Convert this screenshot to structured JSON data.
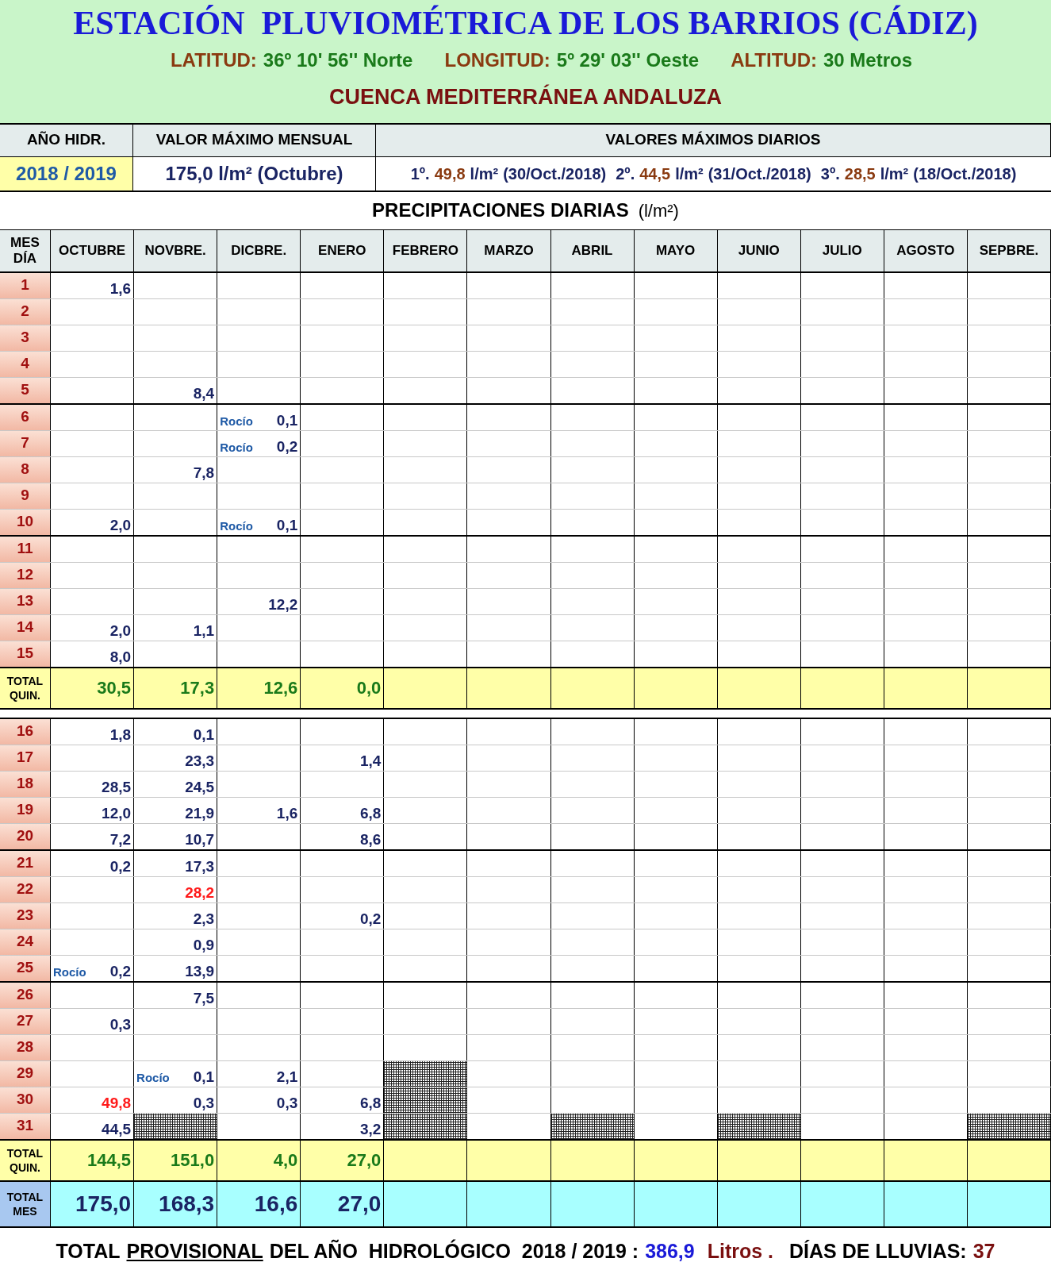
{
  "title": "ESTACIÓN  PLUVIOMÉTRICA DE LOS BARRIOS (CÁDIZ)",
  "coordinates": [
    {
      "label": "LATITUD:",
      "value": "36º 10' 56'' Norte"
    },
    {
      "label": "LONGITUD:",
      "value": "5º 29' 03'' Oeste"
    },
    {
      "label": "ALTITUD:",
      "value": "30 Metros"
    }
  ],
  "basin": "CUENCA MEDITERRÁNEA ANDALUZA",
  "summary": {
    "headers": [
      "AÑO HIDR.",
      "VALOR  MÁXIMO  MENSUAL",
      "VALORES  MÁXIMOS  DIARIOS"
    ],
    "year": "2018 / 2019",
    "monthly_max": "175,0 l/m² (Octubre)",
    "daily_max": [
      {
        "rank": "1º.",
        "value": "49,8",
        "unit": "l/m²",
        "date": "(30/Oct./2018)"
      },
      {
        "rank": "2º.",
        "value": "44,5",
        "unit": "l/m²",
        "date": "(31/Oct./2018)"
      },
      {
        "rank": "3º.",
        "value": "28,5",
        "unit": "l/m²",
        "date": "(18/Oct./2018)"
      }
    ]
  },
  "table_title": {
    "text": "PRECIPITACIONES  DIARIAS",
    "unit": "(l/m²)"
  },
  "corner_header": [
    "MES",
    "DÍA"
  ],
  "months": [
    "OCTUBRE",
    "NOVBRE.",
    "DICBRE.",
    "ENERO",
    "FEBRERO",
    "MARZO",
    "ABRIL",
    "MAYO",
    "JUNIO",
    "JULIO",
    "AGOSTO",
    "SEPBRE."
  ],
  "halves": [
    {
      "groups": [
        {
          "rows": [
            {
              "day": "1",
              "cells": [
                {
                  "kind": "value",
                  "value": "1,6",
                  "highlight": false
                }
              ]
            },
            {
              "day": "2",
              "cells": []
            },
            {
              "day": "3",
              "cells": []
            },
            {
              "day": "4",
              "cells": []
            },
            {
              "day": "5",
              "cells": [
                {
                  "kind": "empty"
                },
                {
                  "kind": "value",
                  "value": "8,4",
                  "highlight": false
                }
              ]
            }
          ]
        },
        {
          "rows": [
            {
              "day": "6",
              "cells": [
                {
                  "kind": "empty"
                },
                {
                  "kind": "empty"
                },
                {
                  "kind": "dew",
                  "note": "Rocío",
                  "value": "0,1"
                }
              ]
            },
            {
              "day": "7",
              "cells": [
                {
                  "kind": "empty"
                },
                {
                  "kind": "empty"
                },
                {
                  "kind": "dew",
                  "note": "Rocío",
                  "value": "0,2"
                }
              ]
            },
            {
              "day": "8",
              "cells": [
                {
                  "kind": "empty"
                },
                {
                  "kind": "value",
                  "value": "7,8",
                  "highlight": false
                }
              ]
            },
            {
              "day": "9",
              "cells": []
            },
            {
              "day": "10",
              "cells": [
                {
                  "kind": "value",
                  "value": "2,0",
                  "highlight": false
                },
                {
                  "kind": "empty"
                },
                {
                  "kind": "dew",
                  "note": "Rocío",
                  "value": "0,1"
                }
              ]
            }
          ]
        },
        {
          "rows": [
            {
              "day": "11",
              "cells": []
            },
            {
              "day": "12",
              "cells": []
            },
            {
              "day": "13",
              "cells": [
                {
                  "kind": "empty"
                },
                {
                  "kind": "empty"
                },
                {
                  "kind": "value",
                  "value": "12,2",
                  "highlight": false
                }
              ]
            },
            {
              "day": "14",
              "cells": [
                {
                  "kind": "value",
                  "value": "2,0",
                  "highlight": false
                },
                {
                  "kind": "value",
                  "value": "1,1",
                  "highlight": false
                }
              ]
            },
            {
              "day": "15",
              "cells": [
                {
                  "kind": "value",
                  "value": "8,0",
                  "highlight": false
                }
              ]
            }
          ]
        }
      ],
      "total_label": "TOTAL QUIN.",
      "totals": [
        "30,5",
        "17,3",
        "12,6",
        "0,0"
      ]
    },
    {
      "groups": [
        {
          "rows": [
            {
              "day": "16",
              "cells": [
                {
                  "kind": "value",
                  "value": "1,8",
                  "highlight": false
                },
                {
                  "kind": "value",
                  "value": "0,1",
                  "highlight": false
                }
              ]
            },
            {
              "day": "17",
              "cells": [
                {
                  "kind": "empty"
                },
                {
                  "kind": "value",
                  "value": "23,3",
                  "highlight": false
                },
                {
                  "kind": "empty"
                },
                {
                  "kind": "value",
                  "value": "1,4",
                  "highlight": false
                }
              ]
            },
            {
              "day": "18",
              "cells": [
                {
                  "kind": "value",
                  "value": "28,5",
                  "highlight": false
                },
                {
                  "kind": "value",
                  "value": "24,5",
                  "highlight": false
                }
              ]
            },
            {
              "day": "19",
              "cells": [
                {
                  "kind": "value",
                  "value": "12,0",
                  "highlight": false
                },
                {
                  "kind": "value",
                  "value": "21,9",
                  "highlight": false
                },
                {
                  "kind": "value",
                  "value": "1,6",
                  "highlight": false
                },
                {
                  "kind": "value",
                  "value": "6,8",
                  "highlight": false
                }
              ]
            },
            {
              "day": "20",
              "cells": [
                {
                  "kind": "value",
                  "value": "7,2",
                  "highlight": false
                },
                {
                  "kind": "value",
                  "value": "10,7",
                  "highlight": false
                },
                {
                  "kind": "empty"
                },
                {
                  "kind": "value",
                  "value": "8,6",
                  "highlight": false
                }
              ]
            }
          ]
        },
        {
          "rows": [
            {
              "day": "21",
              "cells": [
                {
                  "kind": "value",
                  "value": "0,2",
                  "highlight": false
                },
                {
                  "kind": "value",
                  "value": "17,3",
                  "highlight": false
                }
              ]
            },
            {
              "day": "22",
              "cells": [
                {
                  "kind": "empty"
                },
                {
                  "kind": "value",
                  "value": "28,2",
                  "highlight": true
                }
              ]
            },
            {
              "day": "23",
              "cells": [
                {
                  "kind": "empty"
                },
                {
                  "kind": "value",
                  "value": "2,3",
                  "highlight": false
                },
                {
                  "kind": "empty"
                },
                {
                  "kind": "value",
                  "value": "0,2",
                  "highlight": false
                }
              ]
            },
            {
              "day": "24",
              "cells": [
                {
                  "kind": "empty"
                },
                {
                  "kind": "value",
                  "value": "0,9",
                  "highlight": false
                }
              ]
            },
            {
              "day": "25",
              "cells": [
                {
                  "kind": "dew",
                  "note": "Rocío",
                  "value": "0,2"
                },
                {
                  "kind": "value",
                  "value": "13,9",
                  "highlight": false
                }
              ]
            }
          ]
        },
        {
          "rows": [
            {
              "day": "26",
              "cells": [
                {
                  "kind": "empty"
                },
                {
                  "kind": "value",
                  "value": "7,5",
                  "highlight": false
                }
              ]
            },
            {
              "day": "27",
              "cells": [
                {
                  "kind": "value",
                  "value": "0,3",
                  "highlight": false
                }
              ]
            },
            {
              "day": "28",
              "cells": []
            },
            {
              "day": "29",
              "cells": [
                {
                  "kind": "empty"
                },
                {
                  "kind": "dew",
                  "note": "Rocío",
                  "value": "0,1"
                },
                {
                  "kind": "value",
                  "value": "2,1",
                  "highlight": false
                },
                {
                  "kind": "empty"
                },
                {
                  "kind": "hatched"
                }
              ]
            },
            {
              "day": "30",
              "cells": [
                {
                  "kind": "value",
                  "value": "49,8",
                  "highlight": true
                },
                {
                  "kind": "value",
                  "value": "0,3",
                  "highlight": false
                },
                {
                  "kind": "value",
                  "value": "0,3",
                  "highlight": false
                },
                {
                  "kind": "value",
                  "value": "6,8",
                  "highlight": false
                },
                {
                  "kind": "hatched"
                }
              ]
            },
            {
              "day": "31",
              "cells": [
                {
                  "kind": "value",
                  "value": "44,5",
                  "highlight": false
                },
                {
                  "kind": "hatched"
                },
                {
                  "kind": "empty"
                },
                {
                  "kind": "value",
                  "value": "3,2",
                  "highlight": false
                },
                {
                  "kind": "hatched"
                },
                {
                  "kind": "empty"
                },
                {
                  "kind": "hatched"
                },
                {
                  "kind": "empty"
                },
                {
                  "kind": "hatched"
                },
                {
                  "kind": "empty"
                },
                {
                  "kind": "empty"
                },
                {
                  "kind": "hatched"
                }
              ]
            }
          ]
        }
      ],
      "total_label": "TOTAL QUIN.",
      "totals": [
        "144,5",
        "151,0",
        "4,0",
        "27,0"
      ]
    }
  ],
  "month_total": {
    "label": "TOTAL MES",
    "values": [
      "175,0",
      "168,3",
      "16,6",
      "27,0"
    ]
  },
  "footer": {
    "prefix": "TOTAL",
    "underlined": "PROVISIONAL",
    "middle": "DEL AÑO  HIDROLÓGICO  2018 / 2019 :",
    "total": "386,9",
    "unit": "Litros .",
    "days_label": "DÍAS DE LLUVIAS:",
    "days": "37"
  }
}
